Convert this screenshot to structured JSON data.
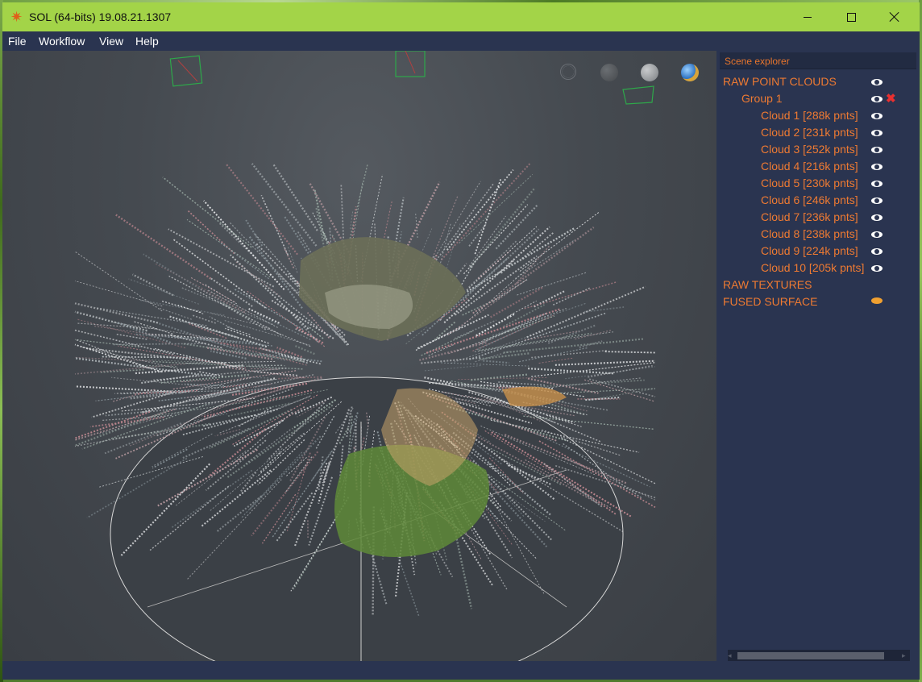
{
  "window": {
    "title": "SOL (64-bits) 19.08.21.1307"
  },
  "menu": {
    "items": [
      "File",
      "Workflow",
      "View",
      "Help"
    ]
  },
  "viewport": {
    "view_controls": [
      "wireframe-globe-icon",
      "dark-sphere-icon",
      "light-sphere-icon",
      "earth-globe-icon"
    ]
  },
  "scene_explorer": {
    "title": "Scene explorer",
    "raw_point_clouds": "RAW POINT CLOUDS",
    "group": {
      "label": "Group 1"
    },
    "clouds": [
      "Cloud 1 [288k pnts]",
      "Cloud 2 [231k pnts]",
      "Cloud 3 [252k pnts]",
      "Cloud 4 [216k pnts]",
      "Cloud 5 [230k pnts]",
      "Cloud 6 [246k pnts]",
      "Cloud 7 [236k pnts]",
      "Cloud 8 [238k pnts]",
      "Cloud 9 [224k pnts]",
      "Cloud 10 [205k pnts]"
    ],
    "raw_textures": "RAW TEXTURES",
    "fused_surface": "FUSED SURFACE"
  },
  "colors": {
    "titlebar": "#a3d448",
    "background": "#2a3450",
    "tree_text": "#ee7a32",
    "delete": "#e83030"
  }
}
